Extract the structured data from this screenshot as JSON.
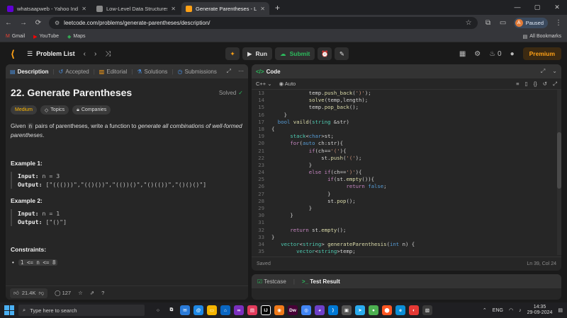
{
  "browser": {
    "tabs": [
      {
        "title": "whatsaapweb - Yahoo India Se",
        "color": "#6001d2"
      },
      {
        "title": "Low-Level Data Structures.",
        "color": "#888888"
      },
      {
        "title": "Generate Parentheses - LeetCo",
        "color": "#ffa116"
      }
    ],
    "url": "leetcode.com/problems/generate-parentheses/description/",
    "profile_label": "Paused",
    "profile_initial": "A",
    "bookmarks": [
      "Gmail",
      "YouTube",
      "Maps"
    ],
    "all_bookmarks": "All Bookmarks"
  },
  "lc": {
    "problem_list": "Problem List",
    "run": "Run",
    "submit": "Submit",
    "streak": "0",
    "premium": "Premium"
  },
  "left_tabs": [
    "Description",
    "Accepted",
    "Editorial",
    "Solutions",
    "Submissions"
  ],
  "problem": {
    "title": "22. Generate Parentheses",
    "solved": "Solved",
    "difficulty": "Medium",
    "topics": "Topics",
    "companies": "Companies",
    "text_1": "Given ",
    "text_n": "n",
    "text_2": " pairs of parentheses, write a function to ",
    "text_em": "generate all combinations of well-formed parentheses",
    "text_3": ".",
    "ex1_h": "Example 1:",
    "ex1_input_label": "Input:",
    "ex1_input": "n = 3",
    "ex1_output_label": "Output:",
    "ex1_output": "[\"((()))\",\"(()())\",\"(())()\",\"()(())\",\"()()()\"]",
    "ex2_h": "Example 2:",
    "ex2_input_label": "Input:",
    "ex2_input": "n = 1",
    "ex2_output_label": "Output:",
    "ex2_output": "[\"()\"]",
    "constraints_h": "Constraints:",
    "constraint": "1 <= n <= 8",
    "likes": "21.4K",
    "comments": "127"
  },
  "code_panel": {
    "title": "Code",
    "language": "C++",
    "mode": "Auto",
    "status": "Saved",
    "cursor": "Ln 39, Col 24"
  },
  "bottom_panel": {
    "testcase": "Testcase",
    "test_result": "Test Result"
  },
  "taskbar": {
    "search": "Type here to search",
    "lang": "ENG",
    "time": "14:35",
    "date": "29-09-2024"
  }
}
